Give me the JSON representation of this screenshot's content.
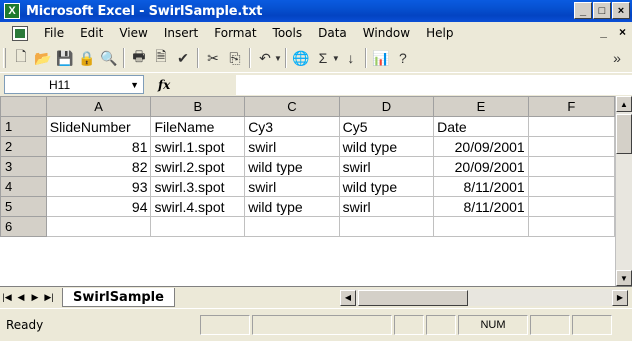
{
  "window": {
    "title": "Microsoft Excel - SwirlSample.txt",
    "app_icon_letter": "X"
  },
  "menu": {
    "items": [
      "File",
      "Edit",
      "View",
      "Insert",
      "Format",
      "Tools",
      "Data",
      "Window",
      "Help"
    ],
    "right": [
      "_",
      "×"
    ]
  },
  "toolbar": {
    "icons": [
      "new-icon",
      "open-icon",
      "save-icon",
      "permission-icon",
      "research-icon",
      "print-icon",
      "print-preview-icon",
      "spelling-icon",
      "cut-icon",
      "copy-icon",
      "undo-icon",
      "hyperlink-icon",
      "autosum-icon",
      "sort-ascending-icon",
      "chart-wizard-icon",
      "help-icon"
    ],
    "more_symbol": "»"
  },
  "formula_bar": {
    "name_box": "H11",
    "fx_label": "fx",
    "formula": ""
  },
  "sheet": {
    "columns": [
      "A",
      "B",
      "C",
      "D",
      "E",
      "F"
    ],
    "rows": [
      {
        "row": "1",
        "cells": [
          "SlideNumber",
          "FileName",
          "Cy3",
          "Cy5",
          "Date",
          ""
        ]
      },
      {
        "row": "2",
        "cells": [
          "81",
          "swirl.1.spot",
          "swirl",
          "wild type",
          "20/09/2001",
          ""
        ]
      },
      {
        "row": "3",
        "cells": [
          "82",
          "swirl.2.spot",
          "wild type",
          "swirl",
          "20/09/2001",
          ""
        ]
      },
      {
        "row": "4",
        "cells": [
          "93",
          "swirl.3.spot",
          "swirl",
          "wild type",
          "8/11/2001",
          ""
        ]
      },
      {
        "row": "5",
        "cells": [
          "94",
          "swirl.4.spot",
          "wild type",
          "swirl",
          "8/11/2001",
          ""
        ]
      },
      {
        "row": "6",
        "cells": [
          "",
          "",
          "",
          "",
          "",
          ""
        ]
      }
    ]
  },
  "tabs": {
    "active": "SwirlSample"
  },
  "status": {
    "text": "Ready",
    "num_indicator": "NUM"
  }
}
